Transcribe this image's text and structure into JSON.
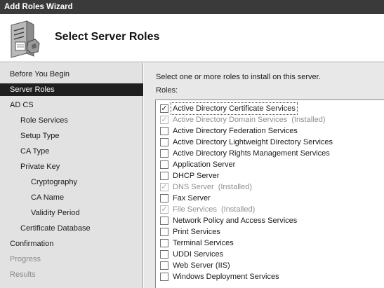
{
  "window": {
    "title": "Add Roles Wizard"
  },
  "header": {
    "title": "Select Server Roles",
    "icon": "server-roles-icon"
  },
  "sidebar": {
    "items": [
      {
        "label": "Before You Begin",
        "level": 0,
        "state": "normal"
      },
      {
        "label": "Server Roles",
        "level": 0,
        "state": "active"
      },
      {
        "label": "AD CS",
        "level": 0,
        "state": "normal"
      },
      {
        "label": "Role Services",
        "level": 1,
        "state": "normal"
      },
      {
        "label": "Setup Type",
        "level": 1,
        "state": "normal"
      },
      {
        "label": "CA Type",
        "level": 1,
        "state": "normal"
      },
      {
        "label": "Private Key",
        "level": 1,
        "state": "normal"
      },
      {
        "label": "Cryptography",
        "level": 2,
        "state": "normal"
      },
      {
        "label": "CA Name",
        "level": 2,
        "state": "normal"
      },
      {
        "label": "Validity Period",
        "level": 2,
        "state": "normal"
      },
      {
        "label": "Certificate Database",
        "level": 1,
        "state": "normal"
      },
      {
        "label": "Confirmation",
        "level": 0,
        "state": "normal"
      },
      {
        "label": "Progress",
        "level": 0,
        "state": "disabled"
      },
      {
        "label": "Results",
        "level": 0,
        "state": "disabled"
      }
    ]
  },
  "main": {
    "instruction": "Select one or more roles to install on this server.",
    "roles_label": "Roles:",
    "roles": [
      {
        "name": "Active Directory Certificate Services",
        "checked": true,
        "disabled": false,
        "note": "",
        "selected": true
      },
      {
        "name": "Active Directory Domain Services",
        "checked": true,
        "disabled": true,
        "note": "(Installed)",
        "selected": false
      },
      {
        "name": "Active Directory Federation Services",
        "checked": false,
        "disabled": false,
        "note": "",
        "selected": false
      },
      {
        "name": "Active Directory Lightweight Directory Services",
        "checked": false,
        "disabled": false,
        "note": "",
        "selected": false
      },
      {
        "name": "Active Directory Rights Management Services",
        "checked": false,
        "disabled": false,
        "note": "",
        "selected": false
      },
      {
        "name": "Application Server",
        "checked": false,
        "disabled": false,
        "note": "",
        "selected": false
      },
      {
        "name": "DHCP Server",
        "checked": false,
        "disabled": false,
        "note": "",
        "selected": false
      },
      {
        "name": "DNS Server",
        "checked": true,
        "disabled": true,
        "note": "(Installed)",
        "selected": false
      },
      {
        "name": "Fax Server",
        "checked": false,
        "disabled": false,
        "note": "",
        "selected": false
      },
      {
        "name": "File Services",
        "checked": true,
        "disabled": true,
        "note": "(Installed)",
        "selected": false
      },
      {
        "name": "Network Policy and Access Services",
        "checked": false,
        "disabled": false,
        "note": "",
        "selected": false
      },
      {
        "name": "Print Services",
        "checked": false,
        "disabled": false,
        "note": "",
        "selected": false
      },
      {
        "name": "Terminal Services",
        "checked": false,
        "disabled": false,
        "note": "",
        "selected": false
      },
      {
        "name": "UDDI Services",
        "checked": false,
        "disabled": false,
        "note": "",
        "selected": false
      },
      {
        "name": "Web Server (IIS)",
        "checked": false,
        "disabled": false,
        "note": "",
        "selected": false
      },
      {
        "name": "Windows Deployment Services",
        "checked": false,
        "disabled": false,
        "note": "",
        "selected": false
      }
    ]
  }
}
